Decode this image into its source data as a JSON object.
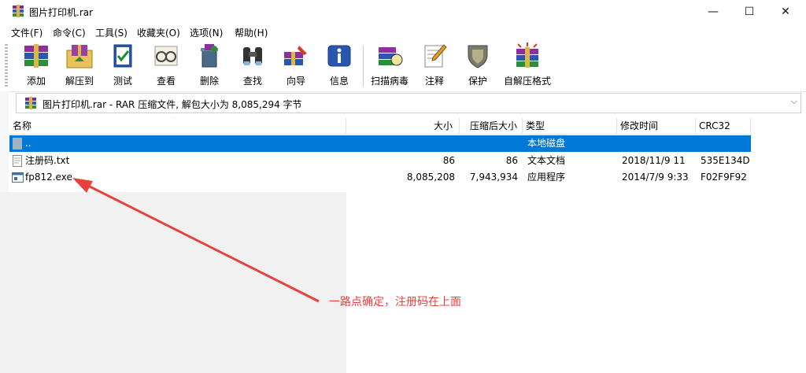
{
  "window": {
    "title": "图片打印机.rar",
    "minimize_glyph": "—",
    "maximize_glyph": "☐",
    "close_glyph": "✕"
  },
  "menu": [
    "文件(F)",
    "命令(C)",
    "工具(S)",
    "收藏夹(O)",
    "选项(N)",
    "帮助(H)"
  ],
  "toolbar": {
    "tools": [
      {
        "label": "添加",
        "icon": "add-books-icon"
      },
      {
        "label": "解压到",
        "icon": "extract-folder-icon"
      },
      {
        "label": "测试",
        "icon": "test-book-icon"
      },
      {
        "label": "查看",
        "icon": "view-glasses-icon"
      },
      {
        "label": "删除",
        "icon": "delete-bin-icon"
      },
      {
        "label": "查找",
        "icon": "find-binoculars-icon"
      },
      {
        "label": "向导",
        "icon": "wizard-icon"
      },
      {
        "label": "信息",
        "icon": "info-icon"
      },
      {
        "label": "扫描病毒",
        "icon": "virus-scan-icon"
      },
      {
        "label": "注释",
        "icon": "comment-pen-icon"
      },
      {
        "label": "保护",
        "icon": "protect-shield-icon"
      },
      {
        "label": "自解压格式",
        "icon": "sfx-books-icon"
      }
    ]
  },
  "address": {
    "text": "图片打印机.rar - RAR 压缩文件, 解包大小为 8,085,294 字节",
    "dropdown_glyph": "⌵"
  },
  "columns": {
    "name": "名称",
    "size": "大小",
    "packed": "压缩后大小",
    "type": "类型",
    "modified": "修改时间",
    "crc": "CRC32"
  },
  "files": [
    {
      "name": "..",
      "size": "",
      "packed": "",
      "type": "本地磁盘",
      "modified": "",
      "crc": "",
      "icon": "parent-folder-icon"
    },
    {
      "name": "注册码.txt",
      "size": "86",
      "packed": "86",
      "type": "文本文档",
      "modified": "2018/11/9 11",
      "crc": "535E134D",
      "icon": "text-file-icon"
    },
    {
      "name": "fp812.exe",
      "size": "8,085,208",
      "packed": "7,943,934",
      "type": "应用程序",
      "modified": "2014/7/9 9:33",
      "crc": "F02F9F92",
      "icon": "exe-file-icon"
    }
  ],
  "annotation": {
    "text": "一路点确定，注册码在上面",
    "color": "#e8413c"
  },
  "colors": {
    "selection": "#0078d7"
  }
}
